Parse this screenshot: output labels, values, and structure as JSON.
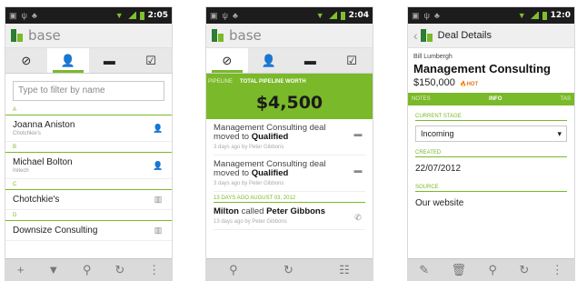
{
  "status": {
    "time1": "2:05",
    "time2": "2:04",
    "time3": "12:0"
  },
  "brand": "base",
  "screen1": {
    "filter_placeholder": "Type to filter by name",
    "sections": [
      "A",
      "B",
      "C",
      "D"
    ],
    "contacts": [
      {
        "name": "Joanna Aniston",
        "sub": "Chotchkie's",
        "icon": "person-icon"
      },
      {
        "name": "Michael Bolton",
        "sub": "Initech",
        "icon": "person-icon"
      },
      {
        "name": "Chotchkie's",
        "sub": "",
        "icon": "company-icon"
      },
      {
        "name": "Downsize Consulting",
        "sub": "",
        "icon": "company-icon"
      }
    ]
  },
  "screen2": {
    "band_left": "PIPELINE",
    "band_current": "TOTAL PIPELINE WORTH",
    "total": "$4,500",
    "items": [
      {
        "pre": "Management Consulting deal moved to ",
        "bold": "Qualified",
        "meta": "3 days ago by Peter Gibbons"
      },
      {
        "pre": "Management Consulting deal moved to ",
        "bold": "Qualified",
        "meta": "3 days ago by Peter Gibbons"
      }
    ],
    "date_header": "13 DAYS AGO AUGUST 03, 2012",
    "call": {
      "who": "Milton",
      "verb": " called ",
      "target": "Peter Gibbons",
      "meta": "13 days ago by Peter Gibbons"
    }
  },
  "screen3": {
    "title": "Deal Details",
    "contact": "Bill Lumbergh",
    "deal": "Management Consulting",
    "amount": "$150,000",
    "hot": "HOT",
    "tabs": [
      "NOTES",
      "INFO",
      "TAS"
    ],
    "stage_label": "CURRENT STAGE",
    "stage_value": "Incoming",
    "created_label": "CREATED",
    "created_value": "22/07/2012",
    "source_label": "SOURCE",
    "source_value": "Our website"
  }
}
